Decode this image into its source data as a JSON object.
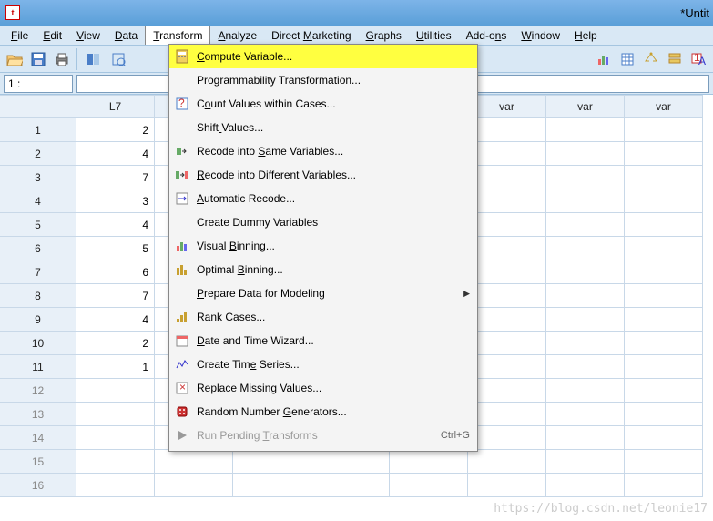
{
  "title": "*Untit",
  "menubar": [
    {
      "label": "File",
      "u": 0
    },
    {
      "label": "Edit",
      "u": 0
    },
    {
      "label": "View",
      "u": 0
    },
    {
      "label": "Data",
      "u": 0
    },
    {
      "label": "Transform",
      "u": 0,
      "active": true
    },
    {
      "label": "Analyze",
      "u": 0
    },
    {
      "label": "Direct Marketing",
      "u": 7
    },
    {
      "label": "Graphs",
      "u": 0
    },
    {
      "label": "Utilities",
      "u": 0
    },
    {
      "label": "Add-ons",
      "u": 5
    },
    {
      "label": "Window",
      "u": 0
    },
    {
      "label": "Help",
      "u": 0
    }
  ],
  "namebox": "1 :",
  "columns": [
    "L7",
    "",
    "",
    "",
    "var",
    "var",
    "var",
    "var"
  ],
  "rows": [
    {
      "n": "1",
      "v": "2"
    },
    {
      "n": "2",
      "v": "4"
    },
    {
      "n": "3",
      "v": "7"
    },
    {
      "n": "4",
      "v": "3"
    },
    {
      "n": "5",
      "v": "4"
    },
    {
      "n": "6",
      "v": "5"
    },
    {
      "n": "7",
      "v": "6"
    },
    {
      "n": "8",
      "v": "7"
    },
    {
      "n": "9",
      "v": "4"
    },
    {
      "n": "10",
      "v": "2"
    },
    {
      "n": "11",
      "v": "1"
    },
    {
      "n": "12",
      "v": ""
    },
    {
      "n": "13",
      "v": ""
    },
    {
      "n": "14",
      "v": ""
    },
    {
      "n": "15",
      "v": ""
    },
    {
      "n": "16",
      "v": ""
    }
  ],
  "dropdown": [
    {
      "label": "Compute Variable...",
      "u": 0,
      "icon": "calc",
      "hl": true
    },
    {
      "label": "Programmability Transformation...",
      "u": -1
    },
    {
      "label": "Count Values within Cases...",
      "u": 1,
      "icon": "count"
    },
    {
      "label": "Shift Values...",
      "u": 5
    },
    {
      "label": "Recode into Same Variables...",
      "u": 12,
      "icon": "recode-same"
    },
    {
      "label": "Recode into Different Variables...",
      "u": 0,
      "icon": "recode-diff"
    },
    {
      "label": "Automatic Recode...",
      "u": 0,
      "icon": "auto-recode"
    },
    {
      "label": "Create Dummy Variables",
      "u": -1
    },
    {
      "label": "Visual Binning...",
      "u": 7,
      "icon": "visual-bin"
    },
    {
      "label": "Optimal Binning...",
      "u": 8,
      "icon": "optimal-bin"
    },
    {
      "label": "Prepare Data for Modeling",
      "u": 0,
      "submenu": true
    },
    {
      "label": "Rank Cases...",
      "u": 3,
      "icon": "rank"
    },
    {
      "label": "Date and Time Wizard...",
      "u": 0,
      "icon": "date"
    },
    {
      "label": "Create Time Series...",
      "u": 10,
      "icon": "timeseries"
    },
    {
      "label": "Replace Missing Values...",
      "u": 16,
      "icon": "replace"
    },
    {
      "label": "Random Number Generators...",
      "u": 14,
      "icon": "random"
    },
    {
      "label": "Run Pending Transforms",
      "u": 12,
      "icon": "run",
      "disabled": true,
      "shortcut": "Ctrl+G"
    }
  ],
  "watermark": "https://blog.csdn.net/leonie17"
}
